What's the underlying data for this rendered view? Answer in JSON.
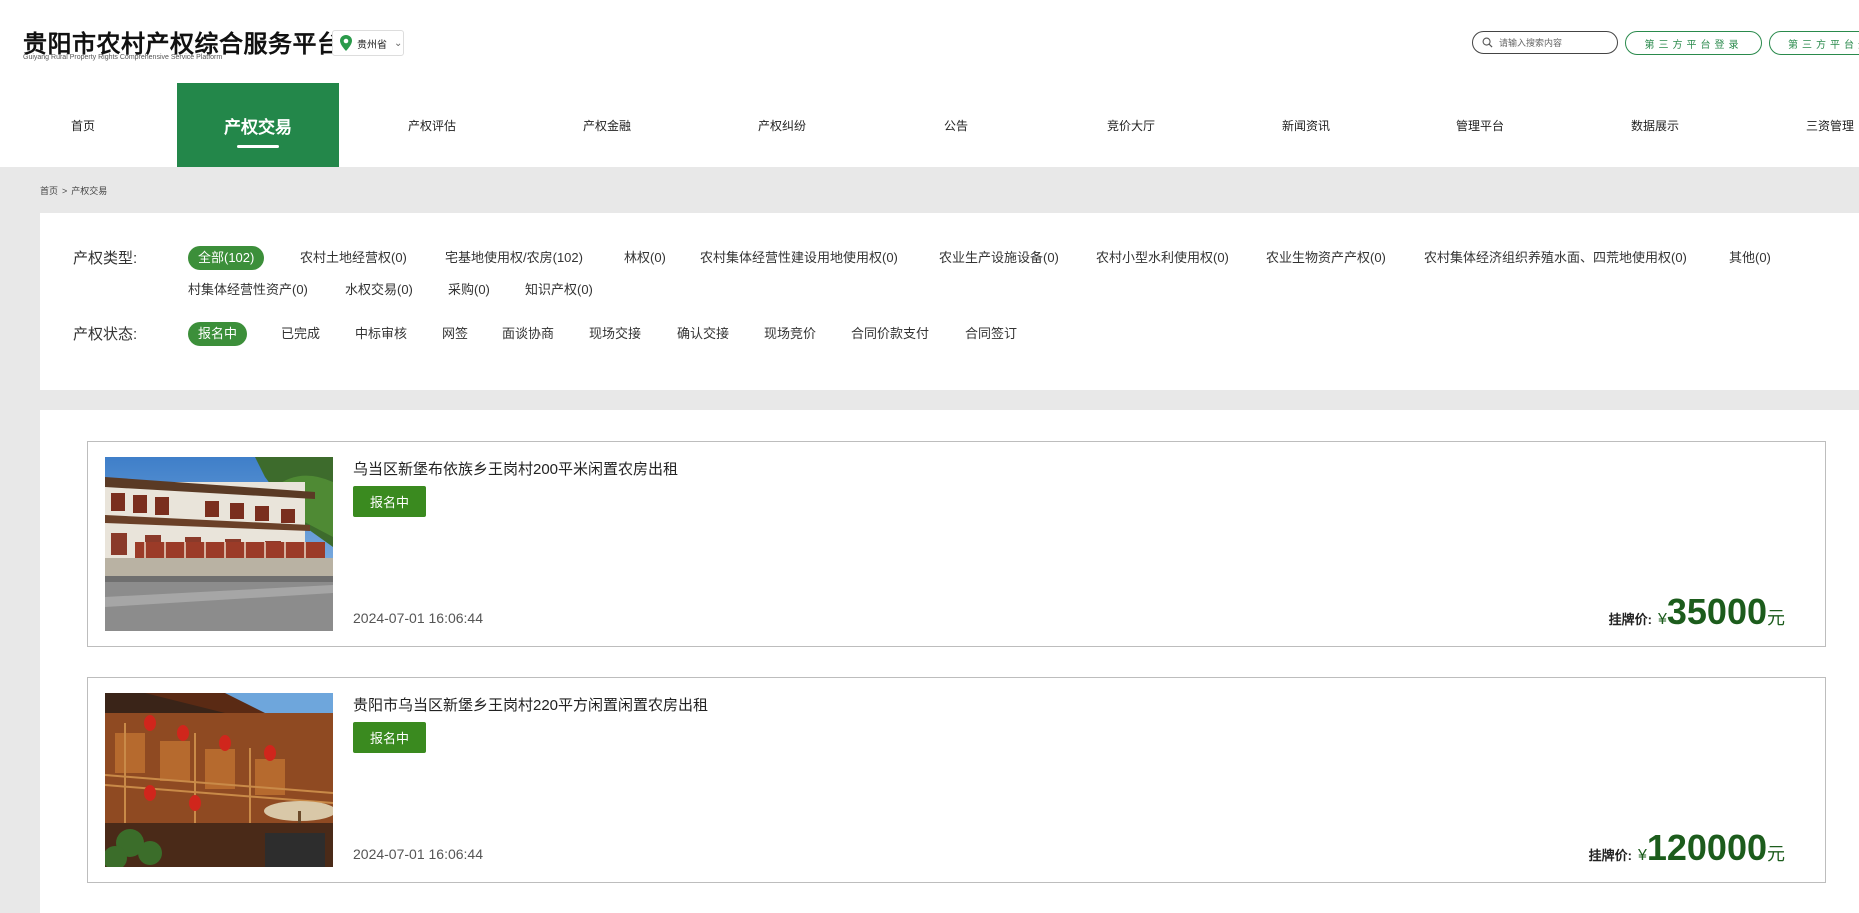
{
  "header": {
    "title": "贵阳市农村产权综合服务平台",
    "subtitle": "Guiyang Rural Property Rights Comprehensive Service Platform",
    "region": "贵州省",
    "search_placeholder": "请输入搜索内容",
    "third_party_login_1": "第三方平台登录",
    "third_party_login_2": "第三方平台登"
  },
  "nav": [
    {
      "label": "首页"
    },
    {
      "label": "产权交易",
      "active": true
    },
    {
      "label": "产权评估"
    },
    {
      "label": "产权金融"
    },
    {
      "label": "产权纠纷"
    },
    {
      "label": "公告"
    },
    {
      "label": "竞价大厅"
    },
    {
      "label": "新闻资讯"
    },
    {
      "label": "管理平台"
    },
    {
      "label": "数据展示"
    },
    {
      "label": "三资管理"
    }
  ],
  "breadcrumb": {
    "home": "首页",
    "separator": ">",
    "current": "产权交易"
  },
  "filters": {
    "type_label": "产权类型:",
    "types": [
      "全部(102)",
      "农村土地经营权(0)",
      "宅基地使用权/农房(102)",
      "林权(0)",
      "农村集体经营性建设用地使用权(0)",
      "农业生产设施设备(0)",
      "农村小型水利使用权(0)",
      "农业生物资产产权(0)",
      "农村集体经济组织养殖水面、四荒地使用权(0)",
      "其他(0)",
      "村集体经营性资产(0)",
      "水权交易(0)",
      "采购(0)",
      "知识产权(0)"
    ],
    "status_label": "产权状态:",
    "statuses": [
      "报名中",
      "已完成",
      "中标审核",
      "网签",
      "面谈协商",
      "现场交接",
      "确认交接",
      "现场竞价",
      "合同价款支付",
      "合同签订"
    ]
  },
  "listings": [
    {
      "title": "乌当区新堡布依族乡王岗村200平米闲置农房出租",
      "status": "报名中",
      "date": "2024-07-01 16:06:44",
      "price_label": "挂牌价:",
      "currency": "¥",
      "price": "35000",
      "unit": "元"
    },
    {
      "title": "贵阳市乌当区新堡乡王岗村220平方闲置闲置农房出租",
      "status": "报名中",
      "date": "2024-07-01 16:06:44",
      "price_label": "挂牌价:",
      "currency": "¥",
      "price": "120000",
      "unit": "元"
    }
  ],
  "colors": {
    "brand_green": "#23874a",
    "price_green": "#1c5c1c",
    "status_green": "#3a8a1f"
  }
}
